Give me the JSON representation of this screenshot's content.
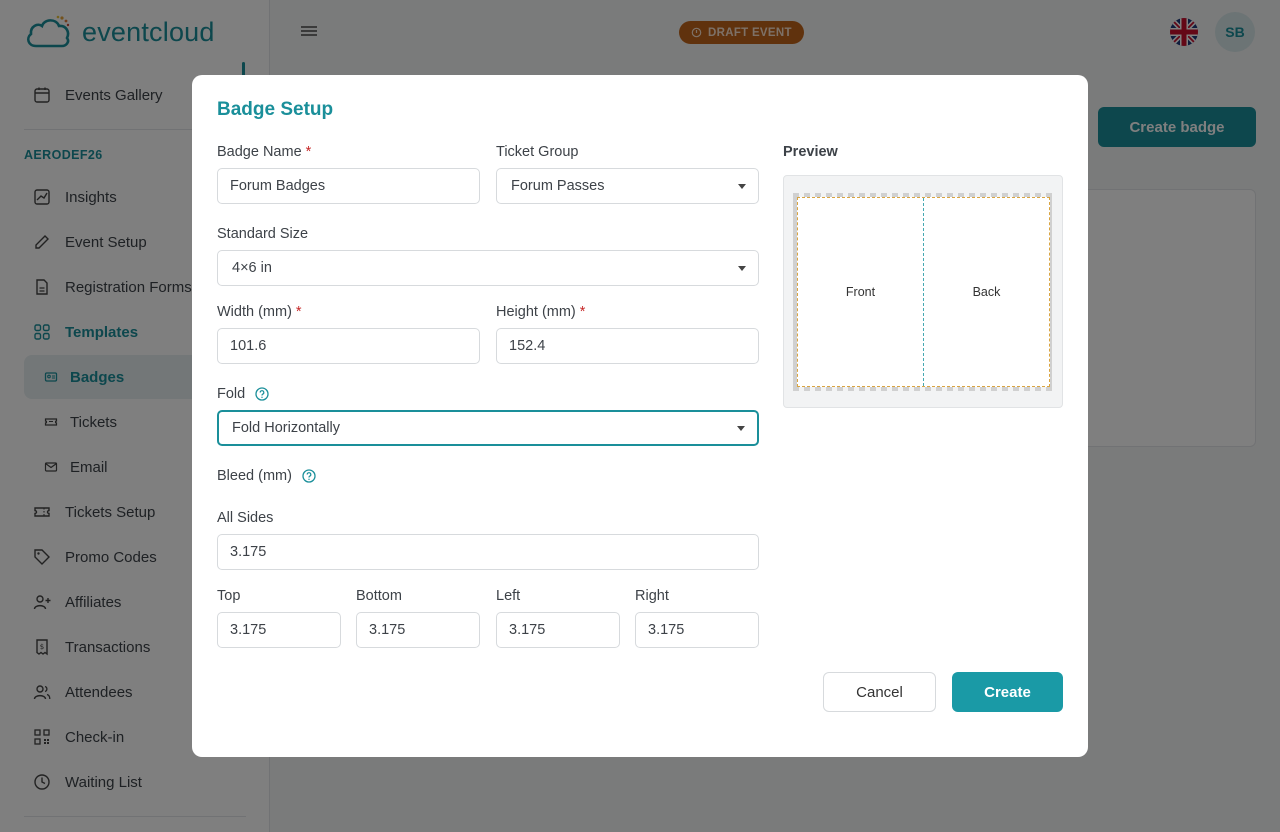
{
  "app": {
    "logo_text": "eventcloud"
  },
  "sidebar": {
    "top_item": "Events Gallery",
    "event_code": "AERODEF26",
    "items": [
      "Insights",
      "Event Setup",
      "Registration Forms",
      "Templates"
    ],
    "sub_items": [
      "Badges",
      "Tickets",
      "Email"
    ],
    "items_after": [
      "Tickets Setup",
      "Promo Codes",
      "Affiliates",
      "Transactions",
      "Attendees",
      "Check-in",
      "Waiting List"
    ]
  },
  "header": {
    "draft_label": "DRAFT EVENT",
    "avatar_initials": "SB"
  },
  "page": {
    "create_badge_label": "Create badge"
  },
  "modal": {
    "title": "Badge Setup",
    "badge_name": {
      "label": "Badge Name",
      "required": "*",
      "value": "Forum Badges"
    },
    "ticket_group": {
      "label": "Ticket Group",
      "value": "Forum Passes"
    },
    "standard_size": {
      "label": "Standard Size",
      "value": "4×6 in"
    },
    "width": {
      "label": "Width (mm)",
      "required": "*",
      "value": "101.6"
    },
    "height": {
      "label": "Height (mm)",
      "required": "*",
      "value": "152.4"
    },
    "fold": {
      "label": "Fold",
      "value": "Fold Horizontally"
    },
    "bleed": {
      "label": "Bleed (mm)"
    },
    "all_sides": {
      "label": "All Sides",
      "value": "3.175"
    },
    "top": {
      "label": "Top",
      "value": "3.175"
    },
    "bottom": {
      "label": "Bottom",
      "value": "3.175"
    },
    "left": {
      "label": "Left",
      "value": "3.175"
    },
    "right": {
      "label": "Right",
      "value": "3.175"
    },
    "preview": {
      "label": "Preview",
      "front": "Front",
      "back": "Back"
    },
    "cancel_label": "Cancel",
    "create_label": "Create"
  },
  "colors": {
    "accent": "#1a8f9a",
    "draft": "#c0651a",
    "required": "#c62828"
  }
}
